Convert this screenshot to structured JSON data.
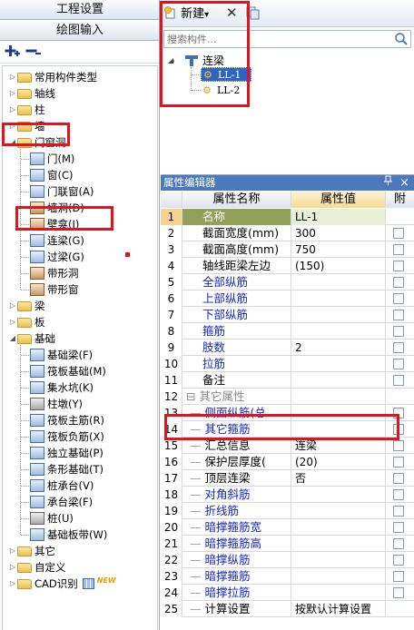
{
  "left": {
    "tab_project_settings": "工程设置",
    "tab_drawing_input": "绘图输入",
    "tree": [
      {
        "label": "常用构件类型",
        "expander": "▷"
      },
      {
        "label": "轴线",
        "expander": "▷"
      },
      {
        "label": "柱",
        "expander": "▷"
      },
      {
        "label": "墙",
        "expander": "▷"
      },
      {
        "label": "门窗洞",
        "expander": "◢"
      },
      {
        "label": "门(M)"
      },
      {
        "label": "窗(C)"
      },
      {
        "label": "门联窗(A)"
      },
      {
        "label": "墙洞(D)"
      },
      {
        "label": "壁龛(I)"
      },
      {
        "label": "连梁(G)"
      },
      {
        "label": "过梁(G)"
      },
      {
        "label": "带形洞"
      },
      {
        "label": "带形窗"
      },
      {
        "label": "梁",
        "expander": "▷"
      },
      {
        "label": "板",
        "expander": "▷"
      },
      {
        "label": "基础",
        "expander": "◢"
      },
      {
        "label": "基础梁(F)"
      },
      {
        "label": "筏板基础(M)"
      },
      {
        "label": "集水坑(K)"
      },
      {
        "label": "柱墩(Y)"
      },
      {
        "label": "筏板主筋(R)"
      },
      {
        "label": "筏板负筋(X)"
      },
      {
        "label": "独立基础(P)"
      },
      {
        "label": "条形基础(T)"
      },
      {
        "label": "桩承台(V)"
      },
      {
        "label": "承台梁(F)"
      },
      {
        "label": "桩(U)"
      },
      {
        "label": "基础板带(W)"
      },
      {
        "label": "其它",
        "expander": "▷"
      },
      {
        "label": "自定义",
        "expander": "▷"
      },
      {
        "label": "CAD识别",
        "expander": "▷",
        "badge": "NEW"
      }
    ]
  },
  "toolbar": {
    "new_label": "新建",
    "new_dropdown": "▾",
    "delete_glyph": "✕"
  },
  "search": {
    "placeholder": "搜索构件..."
  },
  "component_tree": {
    "root": "连梁",
    "items": [
      "LL-1",
      "LL-2"
    ]
  },
  "property_editor": {
    "title": "属性编辑器",
    "pin": "ᵖ",
    "close": "×",
    "headers": {
      "name": "属性名称",
      "value": "属性值",
      "attach": "附"
    },
    "rows": [
      {
        "no": "1",
        "name": "名称",
        "value": "LL-1",
        "blue": false
      },
      {
        "no": "2",
        "name": "截面宽度(mm)",
        "value": "300",
        "blue": false
      },
      {
        "no": "3",
        "name": "截面高度(mm)",
        "value": "750",
        "blue": false
      },
      {
        "no": "4",
        "name": "轴线距梁左边",
        "value": "(150)",
        "blue": false
      },
      {
        "no": "5",
        "name": "全部纵筋",
        "value": "",
        "blue": true
      },
      {
        "no": "6",
        "name": "上部纵筋",
        "value": "",
        "blue": true
      },
      {
        "no": "7",
        "name": "下部纵筋",
        "value": "",
        "blue": true
      },
      {
        "no": "8",
        "name": "箍筋",
        "value": "",
        "blue": true
      },
      {
        "no": "9",
        "name": "肢数",
        "value": "2",
        "blue": true
      },
      {
        "no": "10",
        "name": "拉筋",
        "value": "",
        "blue": true
      },
      {
        "no": "11",
        "name": "备注",
        "value": "",
        "blue": false
      },
      {
        "no": "12",
        "name": "其它属性",
        "value": "",
        "blue": false
      },
      {
        "no": "13",
        "name": "侧面纵筋(总",
        "value": "",
        "blue": true
      },
      {
        "no": "14",
        "name": "其它箍筋",
        "value": "",
        "blue": true
      },
      {
        "no": "15",
        "name": "汇总信息",
        "value": "连梁",
        "blue": false
      },
      {
        "no": "16",
        "name": "保护层厚度(",
        "value": "(20)",
        "blue": false
      },
      {
        "no": "17",
        "name": "顶层连梁",
        "value": "否",
        "blue": false
      },
      {
        "no": "18",
        "name": "对角斜筋",
        "value": "",
        "blue": true
      },
      {
        "no": "19",
        "name": "折线筋",
        "value": "",
        "blue": true
      },
      {
        "no": "20",
        "name": "暗撑箍筋宽",
        "value": "",
        "blue": true
      },
      {
        "no": "21",
        "name": "暗撑箍筋高",
        "value": "",
        "blue": true
      },
      {
        "no": "22",
        "name": "暗撑纵筋",
        "value": "",
        "blue": true
      },
      {
        "no": "23",
        "name": "暗撑箍筋",
        "value": "",
        "blue": true
      },
      {
        "no": "24",
        "name": "暗撑拉筋",
        "value": "",
        "blue": true
      },
      {
        "no": "25",
        "name": "计算设置",
        "value": "按默认计算设置",
        "blue": false
      }
    ]
  },
  "colors": {
    "highlight_red": "#e0141e",
    "title_blue": "#4d79b8",
    "blue_text": "#1426c8",
    "selected_name_bg": "#93a05a"
  }
}
